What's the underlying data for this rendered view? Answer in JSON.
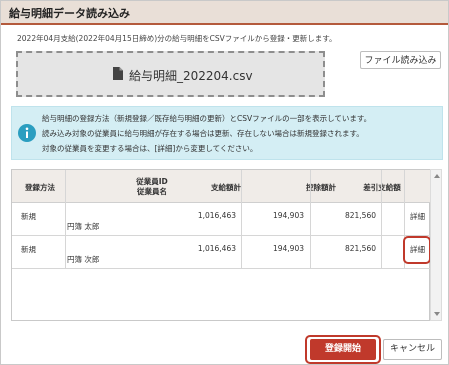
{
  "dialog": {
    "title": "給与明細データ読み込み",
    "info_line": "2022年04月支給(2022年04月15日締め)分の給与明細をCSVファイルから登録・更新します。"
  },
  "upload": {
    "file_icon": "document-icon",
    "file_name": "給与明細_202204.csv",
    "import_button": "ファイル読み込み"
  },
  "notice": {
    "icon": "info-icon",
    "lines": [
      "給与明細の登録方法（新規登録／既存給与明細の更新）とCSVファイルの一部を表示しています。",
      "読み込み対象の従業員に給与明細が存在する場合は更新、存在しない場合は新規登録されます。",
      "対象の従業員を変更する場合は、[詳細]から変更してください。"
    ]
  },
  "table": {
    "headers": {
      "method": "登録方法",
      "employee_id": "従業員ID",
      "employee_name": "従業員名",
      "payment_total": "支給額計",
      "deduction_total": "控除額計",
      "net_pay": "差引支給額"
    },
    "rows": [
      {
        "method": "新規",
        "employee_id": "",
        "employee_name": "円簿 太郎",
        "payment_total": "1,016,463",
        "deduction_total": "194,903",
        "net_pay": "821,560",
        "detail": "詳細"
      },
      {
        "method": "新規",
        "employee_id": "",
        "employee_name": "円簿 次郎",
        "payment_total": "1,016,463",
        "deduction_total": "194,903",
        "net_pay": "821,560",
        "detail": "詳細"
      }
    ]
  },
  "footer": {
    "register_button": "登録開始",
    "cancel_button": "キャンセル"
  },
  "colors": {
    "accent": "#c0392b",
    "title_bar": "#e9dfd7",
    "notice_bg": "#d4eef4"
  }
}
